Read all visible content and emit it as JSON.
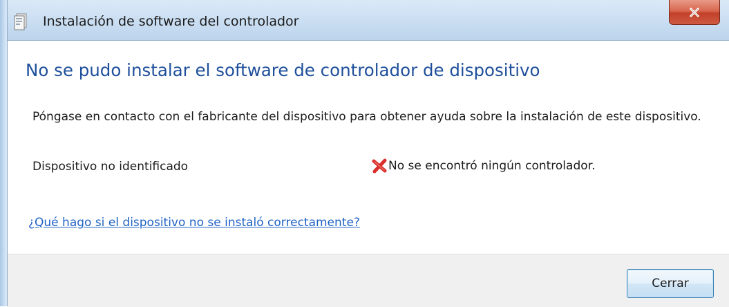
{
  "window": {
    "title": "Instalación de software del controlador",
    "close_icon": "close-x-icon"
  },
  "main": {
    "heading": "No se pudo instalar el software de controlador de dispositivo",
    "description": "Póngase en contacto con el fabricante del dispositivo para obtener ayuda sobre la instalación de este dispositivo.",
    "device": {
      "name": "Dispositivo no identificado",
      "status_icon": "error-x-icon",
      "status": "No se encontró ningún controlador."
    },
    "help_link": "¿Qué hago si el dispositivo no se instaló correctamente?"
  },
  "footer": {
    "close_button": "Cerrar"
  },
  "colors": {
    "heading": "#1e4f9b",
    "link": "#1f63c5",
    "error": "#d9302c"
  }
}
